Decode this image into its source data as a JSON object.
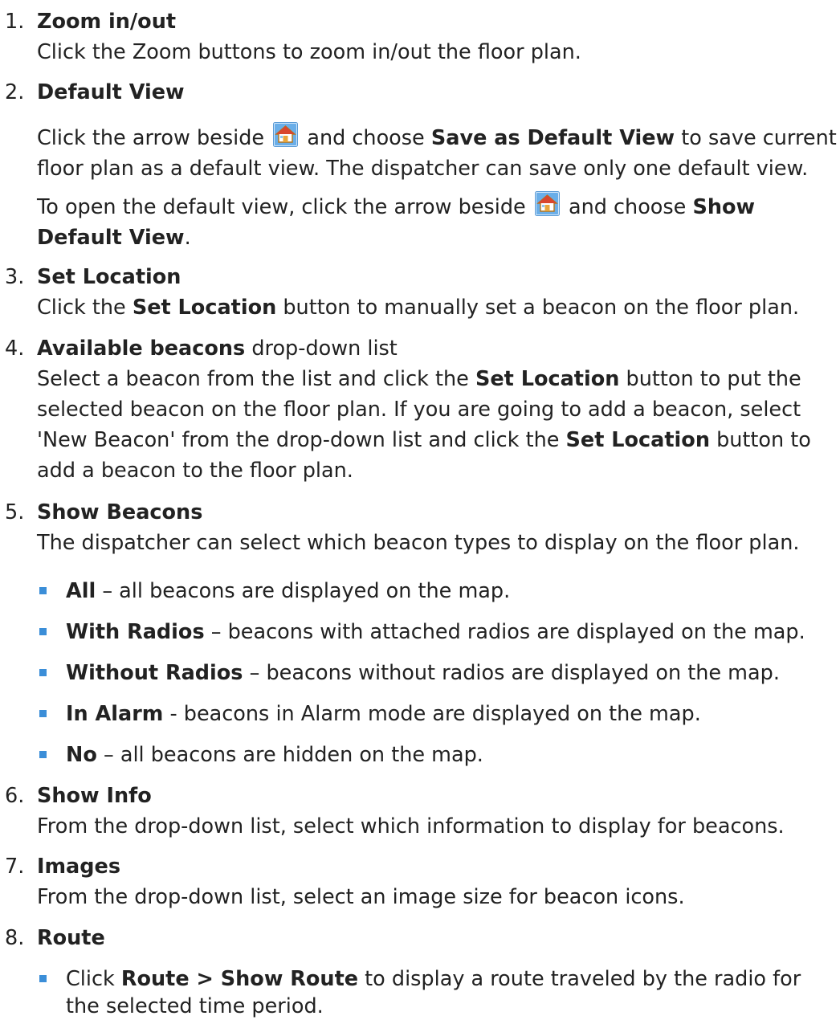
{
  "items": [
    {
      "num": "1.",
      "title": "Zoom in/out",
      "body": "Click the Zoom buttons to zoom in/out the floor plan."
    },
    {
      "num": "2.",
      "title": "Default View",
      "p1_a": "Click the arrow beside",
      "p1_b": "and choose",
      "p1_bold": "Save as Default View",
      "p1_c": "to save current floor plan as a default view. The dispatcher can save only one default view.",
      "p2_a": "To open the default view, click the arrow beside",
      "p2_b": "and choose",
      "p2_bold": "Show Default View",
      "p2_c": "."
    },
    {
      "num": "3.",
      "title": "Set Location",
      "body_a": "Click the",
      "body_bold": "Set Location",
      "body_b": "button to manually set a beacon on the floor plan."
    },
    {
      "num": "4.",
      "title": "Available beacons",
      "title_suffix": "drop-down list",
      "body_a": "Select a beacon from the list and click the",
      "body_bold1": "Set Location",
      "body_b": "button to put the selected beacon on the floor plan. If you are going to add a beacon, select 'New Beacon' from the drop-down list and click the",
      "body_bold2": "Set Location",
      "body_c": "button to add a beacon to the floor plan."
    },
    {
      "num": "5.",
      "title": "Show Beacons",
      "body": "The dispatcher can select which beacon types to display on the floor plan.",
      "bullets": [
        {
          "term": "All",
          "desc": "– all beacons are displayed on the map."
        },
        {
          "term": "With Radios",
          "desc": "– beacons with attached radios are displayed on the map."
        },
        {
          "term": "Without Radios",
          "desc": "– beacons without radios are displayed on the map."
        },
        {
          "term": "In Alarm",
          "desc": "- beacons in Alarm mode are displayed on the map."
        },
        {
          "term": "No",
          "desc": "– all beacons are hidden on the map."
        }
      ]
    },
    {
      "num": "6.",
      "title": "Show Info",
      "body": "From the drop-down list, select which information to display for beacons."
    },
    {
      "num": "7.",
      "title": "Images",
      "body": "From the drop-down list, select an image size for beacon icons."
    },
    {
      "num": "8.",
      "title": "Route",
      "bullets": [
        {
          "a": "Click",
          "bold": "Route > Show Route",
          "b": "to display a route traveled by the radio for the selected time period."
        }
      ]
    }
  ],
  "icons": {
    "default_view": "home-icon"
  },
  "colors": {
    "bullet": "#3b8ed8",
    "icon_bg": "#6aaee8"
  }
}
